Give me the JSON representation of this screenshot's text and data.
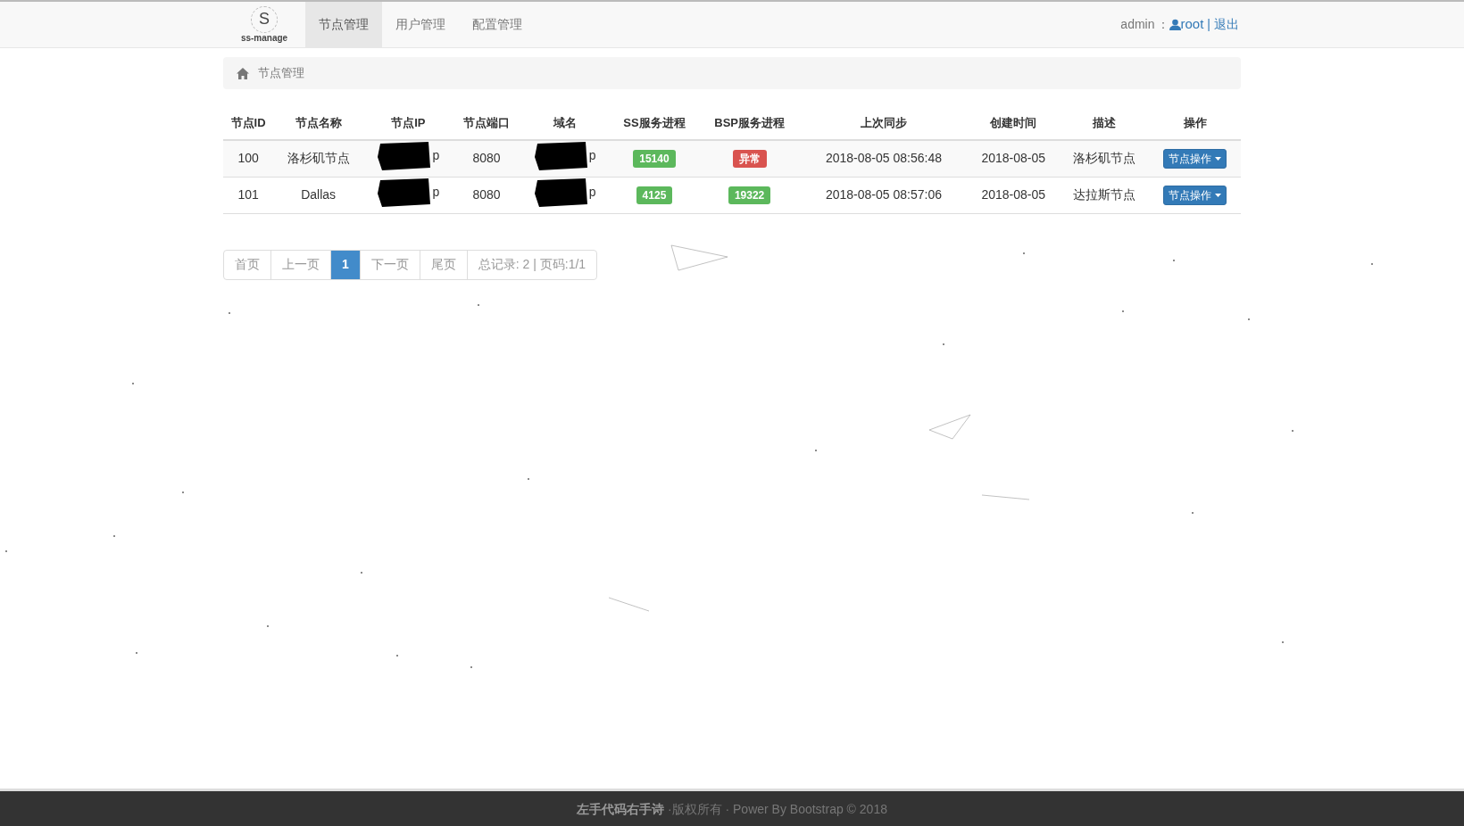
{
  "navbar": {
    "logo_text": "ss-manage",
    "logo_letter": "S",
    "tabs": [
      {
        "label": "节点管理",
        "selected": true
      },
      {
        "label": "用户管理",
        "selected": false
      },
      {
        "label": "配置管理",
        "selected": false
      }
    ],
    "user_label": "admin",
    "separator": "：",
    "user_link": "root",
    "divider": "|",
    "logout": "退出"
  },
  "breadcrumb": {
    "label": "节点管理"
  },
  "table": {
    "columns": [
      "节点ID",
      "节点名称",
      "节点IP",
      "节点端口",
      "域名",
      "SS服务进程",
      "BSP服务进程",
      "上次同步",
      "创建时间",
      "描述",
      "操作"
    ],
    "rows": [
      {
        "id": "100",
        "name": "洛杉矶节点",
        "ip_tail": "p",
        "port": "8080",
        "domain_tail": "p",
        "ss": {
          "text": "15140",
          "color": "#5cb85c"
        },
        "bsp": {
          "text": "异常",
          "color": "#d9534f"
        },
        "last_sync": "2018-08-05 08:56:48",
        "created": "2018-08-05",
        "description": "洛杉矶节点",
        "action": "节点操作"
      },
      {
        "id": "101",
        "name": "Dallas",
        "ip_tail": "p",
        "port": "8080",
        "domain_tail": "p",
        "ss": {
          "text": "4125",
          "color": "#5cb85c"
        },
        "bsp": {
          "text": "19322",
          "color": "#5cb85c"
        },
        "last_sync": "2018-08-05 08:57:06",
        "created": "2018-08-05",
        "description": "达拉斯节点",
        "action": "节点操作"
      }
    ]
  },
  "pagination": [
    {
      "label": "首页",
      "selected": false
    },
    {
      "label": "上一页",
      "selected": false
    },
    {
      "label": "1",
      "selected": true
    },
    {
      "label": "下一页",
      "selected": false
    },
    {
      "label": "尾页",
      "selected": false
    },
    {
      "label": "总记录: 2 | 页码:1/1",
      "selected": false
    }
  ],
  "footer": {
    "author": "左手代码右手诗",
    "rest": "·版权所有 · Power By Bootstrap © 2018"
  }
}
